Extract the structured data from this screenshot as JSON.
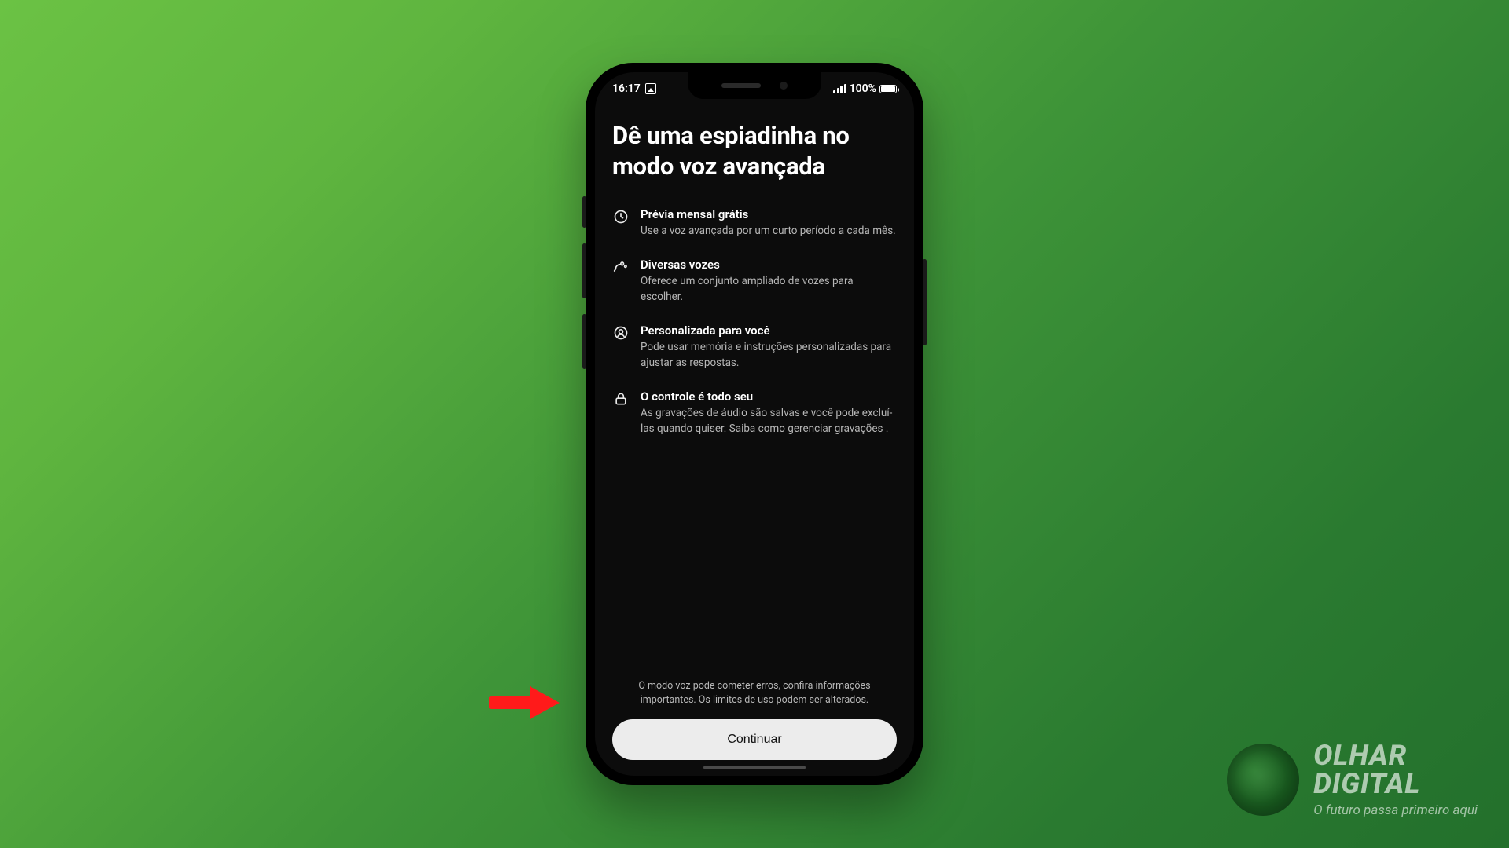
{
  "status": {
    "time": "16:17",
    "battery_pct": "100%"
  },
  "screen": {
    "title": "Dê uma espiadinha no modo voz avançada",
    "features": [
      {
        "icon": "clock",
        "title": "Prévia mensal grátis",
        "desc": "Use a voz avançada por um curto período a cada mês."
      },
      {
        "icon": "voices",
        "title": "Diversas vozes",
        "desc": "Oferece um conjunto ampliado de vozes para escolher."
      },
      {
        "icon": "person",
        "title": "Personalizada para você",
        "desc": "Pode usar memória e instruções personalizadas para ajustar as respostas."
      },
      {
        "icon": "lock",
        "title": "O controle é todo seu",
        "desc_pre": " As gravações de áudio são salvas e você pode excluí-las quando quiser. Saiba como ",
        "desc_link": "gerenciar gravações",
        "desc_post": " ."
      }
    ],
    "disclaimer": "O modo voz pode cometer erros, confira informações importantes. Os limites de uso podem ser alterados.",
    "cta": "Continuar"
  },
  "watermark": {
    "brand1": "OLHAR",
    "brand2": "DIGITAL",
    "tagline": "O futuro passa primeiro aqui"
  }
}
